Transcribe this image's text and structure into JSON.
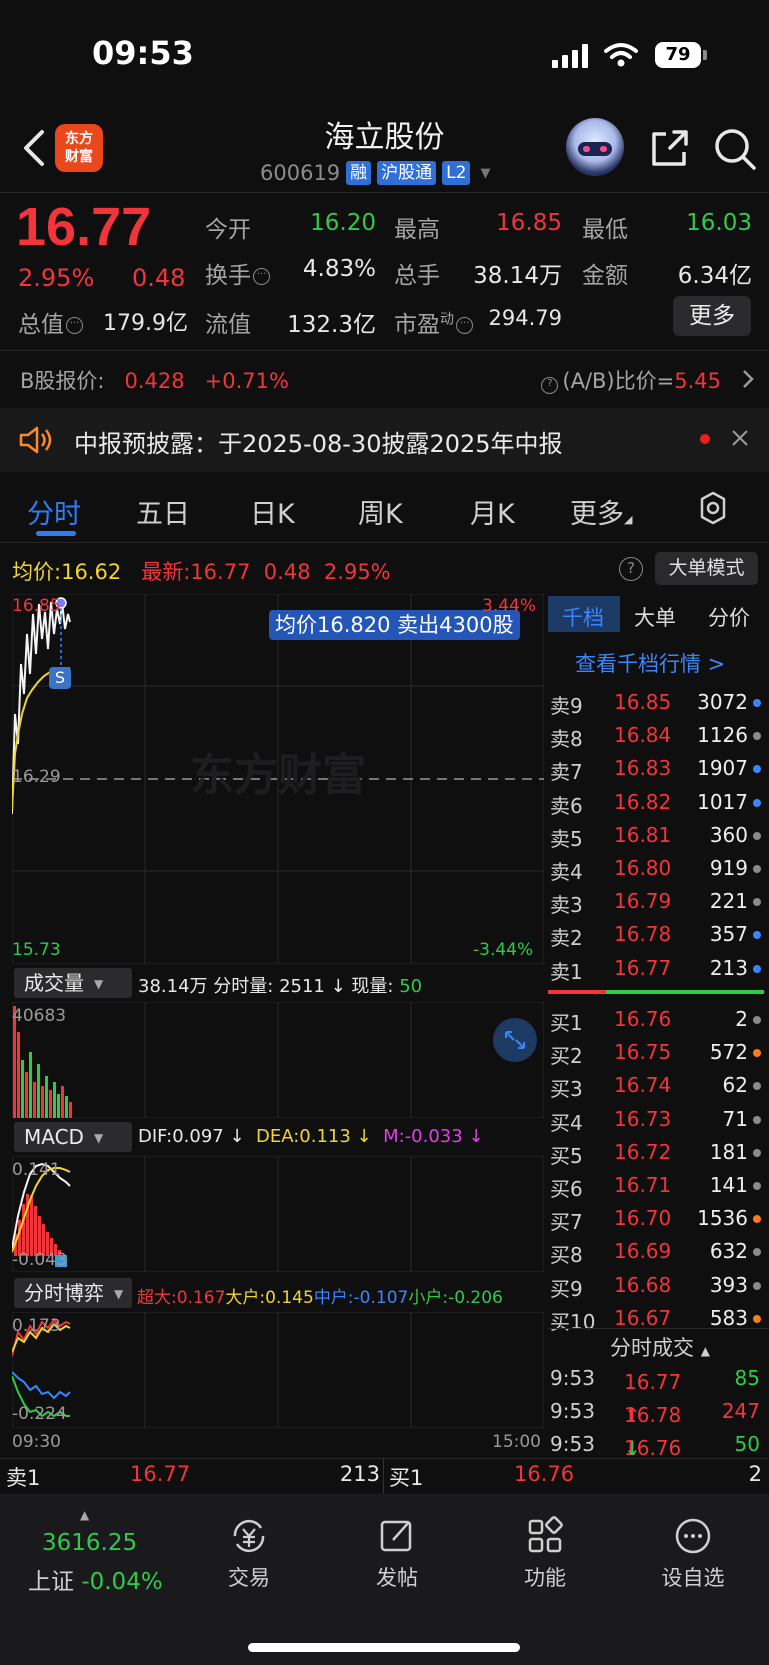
{
  "status_bar": {
    "time": "09:53",
    "battery": "79"
  },
  "header": {
    "stock_name": "海立股份",
    "stock_code": "600619",
    "tags": [
      "融",
      "沪股通",
      "L2"
    ],
    "logo_text_top": "东方",
    "logo_text_bottom": "财富"
  },
  "quote": {
    "last_price": "16.77",
    "change_pct": "2.95%",
    "change_amt": "0.48",
    "open_label": "今开",
    "open": "16.20",
    "high_label": "最高",
    "high": "16.85",
    "low_label": "最低",
    "low": "16.03",
    "turnover_label": "换手",
    "turnover": "4.83%",
    "volume_label": "总手",
    "volume": "38.14万",
    "amount_label": "金额",
    "amount": "6.34亿",
    "mktcap_label": "总值",
    "mktcap": "179.9亿",
    "float_label": "流值",
    "float": "132.3亿",
    "pe_label": "市盈",
    "pe_sup": "动",
    "pe": "294.79",
    "more_label": "更多"
  },
  "bshare": {
    "label": "B股报价:",
    "price": "0.428",
    "change": "+0.71%",
    "ratio_label": "(A/B)比价=",
    "ratio": "5.45"
  },
  "notice": {
    "text": "中报预披露：于2025-08-30披露2025年中报"
  },
  "tabs": [
    "分时",
    "五日",
    "日K",
    "周K",
    "月K",
    "更多"
  ],
  "chart": {
    "avg_label": "均价:",
    "avg": "16.62",
    "latest_label": "最新:",
    "latest": "16.77",
    "latest_chg": "0.48",
    "latest_pct": "2.95%",
    "mode_button": "大单模式",
    "top_price": "16.85",
    "top_pct": "3.44%",
    "mid_price": "16.29",
    "bottom_price": "15.73",
    "bottom_pct": "-3.44%",
    "trade_tip": "均价16.820 卖出4300股",
    "marker": "S",
    "watermark": "东方财富",
    "volume_pill": "成交量",
    "volume_total": "38.14万",
    "volume_detail_label": "分时量:",
    "volume_detail": "2511",
    "now_vol_label": "现量:",
    "now_vol": "50",
    "volume_max": "40683",
    "macd_pill": "MACD",
    "dif": "DIF:0.097",
    "dea": "DEA:0.113",
    "m": "M:-0.033",
    "macd_top": "0.141",
    "macd_bottom": "-0.043",
    "game_pill": "分时博弈",
    "super": "超大:0.167",
    "big": "大户:0.145",
    "mid": "中户:-0.107",
    "small": "小户:-0.206",
    "game_top": "0.173",
    "game_bottom": "-0.224",
    "time_start": "09:30",
    "time_end": "15:00"
  },
  "depth_tabs": [
    "千档",
    "大单",
    "分价"
  ],
  "depth_link": "查看千档行情 >",
  "asks": [
    {
      "label": "卖9",
      "price": "16.85",
      "vol": "3072",
      "dot": "#3a86ff"
    },
    {
      "label": "卖8",
      "price": "16.84",
      "vol": "1126",
      "dot": "#8a8a8a"
    },
    {
      "label": "卖7",
      "price": "16.83",
      "vol": "1907",
      "dot": "#3a86ff"
    },
    {
      "label": "卖6",
      "price": "16.82",
      "vol": "1017",
      "dot": "#3a86ff"
    },
    {
      "label": "卖5",
      "price": "16.81",
      "vol": "360",
      "dot": "#8a8a8a"
    },
    {
      "label": "卖4",
      "price": "16.80",
      "vol": "919",
      "dot": "#8a8a8a"
    },
    {
      "label": "卖3",
      "price": "16.79",
      "vol": "221",
      "dot": "#8a8a8a"
    },
    {
      "label": "卖2",
      "price": "16.78",
      "vol": "357",
      "dot": "#3a86ff"
    },
    {
      "label": "卖1",
      "price": "16.77",
      "vol": "213",
      "dot": "#3a86ff"
    }
  ],
  "bids": [
    {
      "label": "买1",
      "price": "16.76",
      "vol": "2",
      "dot": "#8a8a8a"
    },
    {
      "label": "买2",
      "price": "16.75",
      "vol": "572",
      "dot": "#ff7a1a"
    },
    {
      "label": "买3",
      "price": "16.74",
      "vol": "62",
      "dot": "#8a8a8a"
    },
    {
      "label": "买4",
      "price": "16.73",
      "vol": "71",
      "dot": "#8a8a8a"
    },
    {
      "label": "买5",
      "price": "16.72",
      "vol": "181",
      "dot": "#8a8a8a"
    },
    {
      "label": "买6",
      "price": "16.71",
      "vol": "141",
      "dot": "#8a8a8a"
    },
    {
      "label": "买7",
      "price": "16.70",
      "vol": "1536",
      "dot": "#ff7a1a"
    },
    {
      "label": "买8",
      "price": "16.69",
      "vol": "632",
      "dot": "#8a8a8a"
    },
    {
      "label": "买9",
      "price": "16.68",
      "vol": "393",
      "dot": "#8a8a8a"
    },
    {
      "label": "买10",
      "price": "16.67",
      "vol": "583",
      "dot": "#ff7a1a"
    }
  ],
  "trades_title": "分时成交",
  "trades": [
    {
      "time": "9:53",
      "price": "16.77",
      "arrow": "",
      "vol": "85",
      "vol_color": "green",
      "price_color": "red"
    },
    {
      "time": "9:53",
      "price": "16.78",
      "arrow": "↑",
      "vol": "247",
      "vol_color": "red",
      "price_color": "red"
    },
    {
      "time": "9:53",
      "price": "16.76",
      "arrow": "↓",
      "vol": "50",
      "vol_color": "green",
      "price_color": "red"
    }
  ],
  "bottom_quote": {
    "sell_label": "卖1",
    "sell_price": "16.77",
    "sell_vol": "213",
    "buy_label": "买1",
    "buy_price": "16.76",
    "buy_vol": "2"
  },
  "nav": {
    "index_value": "3616.25",
    "index_name": "上证",
    "index_chg": "-0.04%",
    "items": [
      "交易",
      "发帖",
      "功能",
      "设自选"
    ]
  },
  "colors": {
    "up": "#f1353a",
    "down": "#2ecb4a",
    "accent": "#2f7cf6"
  }
}
